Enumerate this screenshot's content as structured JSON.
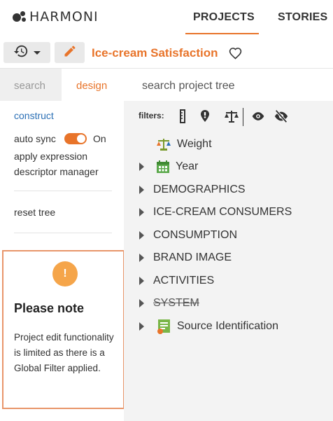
{
  "header": {
    "logo_text": "HARMONI",
    "tabs": [
      {
        "label": "PROJECTS",
        "active": true
      },
      {
        "label": "STORIES",
        "active": false
      }
    ],
    "accent_color": "#e8742a"
  },
  "toolbar": {
    "history_icon": "history-icon",
    "edit_icon": "pencil-icon",
    "project_title": "Ice-cream Satisfaction",
    "favorite_icon": "heart-outline-icon"
  },
  "left_panel": {
    "tabs": [
      {
        "label": "search",
        "active": false
      },
      {
        "label": "design",
        "active": true
      }
    ],
    "construct_link": "construct",
    "auto_sync_label": "auto sync",
    "auto_sync_state": "On",
    "apply_expression": "apply expression descriptor manager",
    "reset_tree": "reset tree",
    "note": {
      "icon": "!",
      "title": "Please note",
      "body": "Project edit functionality is limited as there is a Global Filter applied."
    }
  },
  "right_panel": {
    "search_placeholder": "search project tree",
    "filters_label": "filters:",
    "filter_icons": [
      "ruler-icon",
      "marker-icon",
      "scale-icon",
      "eye-icon",
      "eye-slash-icon"
    ],
    "tree": [
      {
        "label": "Weight",
        "icon": "scale-colored-icon",
        "expandable": false,
        "struck": false
      },
      {
        "label": "Year",
        "icon": "calendar-icon",
        "expandable": true,
        "struck": false
      },
      {
        "label": "DEMOGRAPHICS",
        "icon": null,
        "expandable": true,
        "struck": false
      },
      {
        "label": "ICE-CREAM CONSUMERS",
        "icon": null,
        "expandable": true,
        "struck": false
      },
      {
        "label": "CONSUMPTION",
        "icon": null,
        "expandable": true,
        "struck": false
      },
      {
        "label": "BRAND IMAGE",
        "icon": null,
        "expandable": true,
        "struck": false
      },
      {
        "label": "ACTIVITIES",
        "icon": null,
        "expandable": true,
        "struck": false
      },
      {
        "label": "SYSTEM",
        "icon": null,
        "expandable": true,
        "struck": true
      },
      {
        "label": "Source Identification",
        "icon": "source-id-icon",
        "expandable": true,
        "struck": false
      }
    ]
  }
}
